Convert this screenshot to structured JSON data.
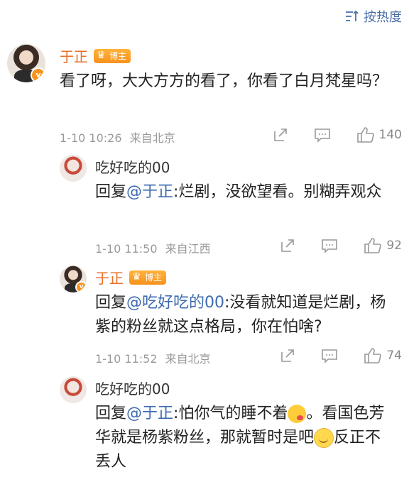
{
  "sort": {
    "label": "按热度"
  },
  "comments": [
    {
      "name": "于正",
      "badge": "博主",
      "text": "看了呀，大大方方的看了，你看了白月梵星吗？",
      "time": "1-10 10:26",
      "location": "来自北京",
      "likes": "140"
    }
  ],
  "replies": [
    {
      "name": "吃好吃的00",
      "prefix": "回复",
      "mention": "@于正",
      "text": ":烂剧，没欲望看。别糊弄观众",
      "time": "1-10 11:50",
      "location": "来自江西",
      "likes": "92"
    },
    {
      "name": "于正",
      "badge": "博主",
      "prefix": "回复",
      "mention": "@吃好吃的00",
      "text": ":没看就知道是烂剧，杨紫的粉丝就这点格局，你在怕啥?",
      "time": "1-10 11:52",
      "location": "来自北京",
      "likes": "74"
    },
    {
      "name": "吃好吃的00",
      "prefix": "回复",
      "mention": "@于正",
      "text_a": ":怕你气的睡不着",
      "text_b": "。看国色芳华就是杨紫粉丝，那就暂时是吧",
      "text_c": "反正不丢人",
      "emoji_a": "kiss-emoji",
      "emoji_b": "smile-emoji"
    }
  ]
}
